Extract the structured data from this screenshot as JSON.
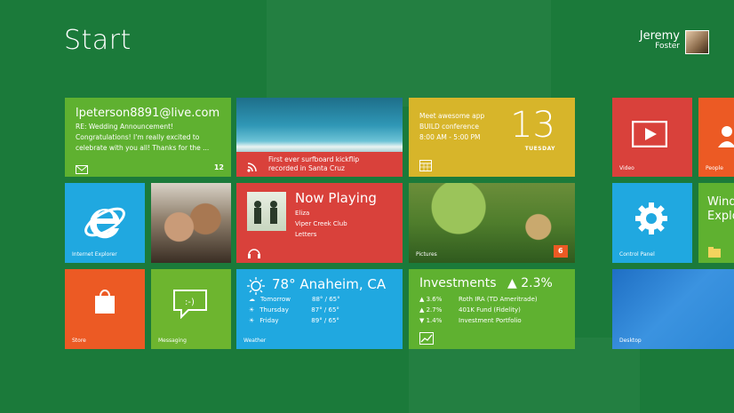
{
  "header": {
    "title": "Start"
  },
  "user": {
    "first_name": "Jeremy",
    "last_name": "Foster"
  },
  "tiles": {
    "mail": {
      "from": "lpeterson8891@live.com",
      "subject": "RE: Wedding Announcement!",
      "line1": "Congratulations! I'm really excited to",
      "line2": "celebrate with you all! Thanks for the ...",
      "count": "12",
      "icon": "mail-icon"
    },
    "photo_news": {
      "caption_line1": "First ever surfboard kickflip",
      "caption_line2": "recorded in Santa Cruz"
    },
    "calendar": {
      "line1": "Meet awesome app",
      "line2": "BUILD conference",
      "line3": "8:00 AM - 5:00 PM",
      "day_number": "13",
      "day_name": "TUESDAY"
    },
    "ie": {
      "label": "Internet Explorer"
    },
    "now_playing": {
      "title": "Now Playing",
      "artist": "Eliza",
      "album": "Viper Creek Club",
      "track": "Letters"
    },
    "pictures": {
      "label": "Pictures",
      "count": "6"
    },
    "store": {
      "label": "Store"
    },
    "messaging": {
      "label": "Messaging"
    },
    "weather": {
      "headline": "78° Anaheim, CA",
      "rows": [
        {
          "day": "Tomorrow",
          "temps": "88° / 65°"
        },
        {
          "day": "Thursday",
          "temps": "87° / 65°"
        },
        {
          "day": "Friday",
          "temps": "89° / 65°"
        }
      ],
      "label": "Weather"
    },
    "investments": {
      "title": "Investments",
      "change": "▲ 2.3%",
      "rows": [
        {
          "pct": "▲ 3.6%",
          "name": "Roth IRA (TD Ameritrade)"
        },
        {
          "pct": "▲ 2.7%",
          "name": "401K Fund (Fidelity)"
        },
        {
          "pct": "▼ 1.4%",
          "name": "Investment Portfolio"
        }
      ]
    },
    "video": {
      "label": "Video"
    },
    "people": {
      "label": "People"
    },
    "windows_explorer": {
      "line1": "Windo",
      "line2": "Explo"
    },
    "control_panel": {
      "label": "Control Panel"
    },
    "desktop": {
      "label": "Desktop"
    }
  },
  "colors": {
    "background": "#1b7a3a",
    "mail": "#5fb130",
    "calendar": "#d7b52a",
    "ie": "#20a8e0",
    "now_playing": "#d9413b",
    "store": "#ec5a24",
    "messaging": "#6db52f",
    "weather": "#20a8e0",
    "investments": "#5fb130",
    "video": "#d9413b",
    "people": "#ec5a24",
    "control_panel": "#20a8e0",
    "windows_explorer": "#5fb130",
    "desktop": "#2c87d6"
  }
}
